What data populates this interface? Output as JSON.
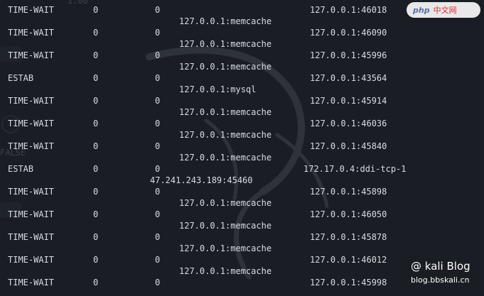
{
  "watermark": {
    "logo_php": "php",
    "logo_cn": "中文网",
    "blog_title": "@ kali Blog",
    "blog_url": "blog.bbskali.cn"
  },
  "ghost_text": {
    "top": "1.00",
    "left": "FALSE"
  },
  "connections": [
    {
      "state": "TIME-WAIT",
      "recv_q": "0",
      "send_q": "0",
      "local": "",
      "peer": "127.0.0.1:46018"
    },
    {
      "state": "",
      "recv_q": "",
      "send_q": "",
      "local": "127.0.0.1:memcache",
      "peer": ""
    },
    {
      "state": "TIME-WAIT",
      "recv_q": "0",
      "send_q": "0",
      "local": "",
      "peer": "127.0.0.1:46090"
    },
    {
      "state": "",
      "recv_q": "",
      "send_q": "",
      "local": "127.0.0.1:memcache",
      "peer": ""
    },
    {
      "state": "TIME-WAIT",
      "recv_q": "0",
      "send_q": "0",
      "local": "",
      "peer": "127.0.0.1:45996"
    },
    {
      "state": "",
      "recv_q": "",
      "send_q": "",
      "local": "127.0.0.1:memcache",
      "peer": ""
    },
    {
      "state": "ESTAB",
      "recv_q": "0",
      "send_q": "0",
      "local": "",
      "peer": "127.0.0.1:43564"
    },
    {
      "state": "",
      "recv_q": "",
      "send_q": "",
      "local": "127.0.0.1:mysql",
      "peer": ""
    },
    {
      "state": "TIME-WAIT",
      "recv_q": "0",
      "send_q": "0",
      "local": "",
      "peer": "127.0.0.1:45914"
    },
    {
      "state": "",
      "recv_q": "",
      "send_q": "",
      "local": "127.0.0.1:memcache",
      "peer": ""
    },
    {
      "state": "TIME-WAIT",
      "recv_q": "0",
      "send_q": "0",
      "local": "",
      "peer": "127.0.0.1:46036"
    },
    {
      "state": "",
      "recv_q": "",
      "send_q": "",
      "local": "127.0.0.1:memcache",
      "peer": ""
    },
    {
      "state": "TIME-WAIT",
      "recv_q": "0",
      "send_q": "0",
      "local": "",
      "peer": "127.0.0.1:45840"
    },
    {
      "state": "",
      "recv_q": "",
      "send_q": "",
      "local": "127.0.0.1:memcache",
      "peer": ""
    },
    {
      "state": "ESTAB",
      "recv_q": "0",
      "send_q": "0",
      "local": "",
      "peer": "172.17.0.4:ddi-tcp-1"
    },
    {
      "state": "",
      "recv_q": "",
      "send_q": "",
      "local": "47.241.243.189:45460",
      "peer": ""
    },
    {
      "state": "TIME-WAIT",
      "recv_q": "0",
      "send_q": "0",
      "local": "",
      "peer": "127.0.0.1:45898"
    },
    {
      "state": "",
      "recv_q": "",
      "send_q": "",
      "local": "127.0.0.1:memcache",
      "peer": ""
    },
    {
      "state": "TIME-WAIT",
      "recv_q": "0",
      "send_q": "0",
      "local": "",
      "peer": "127.0.0.1:46050"
    },
    {
      "state": "",
      "recv_q": "",
      "send_q": "",
      "local": "127.0.0.1:memcache",
      "peer": ""
    },
    {
      "state": "TIME-WAIT",
      "recv_q": "0",
      "send_q": "0",
      "local": "",
      "peer": "127.0.0.1:45878"
    },
    {
      "state": "",
      "recv_q": "",
      "send_q": "",
      "local": "127.0.0.1:memcache",
      "peer": ""
    },
    {
      "state": "TIME-WAIT",
      "recv_q": "0",
      "send_q": "0",
      "local": "",
      "peer": "127.0.0.1:46012"
    },
    {
      "state": "",
      "recv_q": "",
      "send_q": "",
      "local": "127.0.0.1:memcache",
      "peer": ""
    },
    {
      "state": "TIME-WAIT",
      "recv_q": "0",
      "send_q": "0",
      "local": "",
      "peer": "127.0.0.1:45998"
    }
  ]
}
